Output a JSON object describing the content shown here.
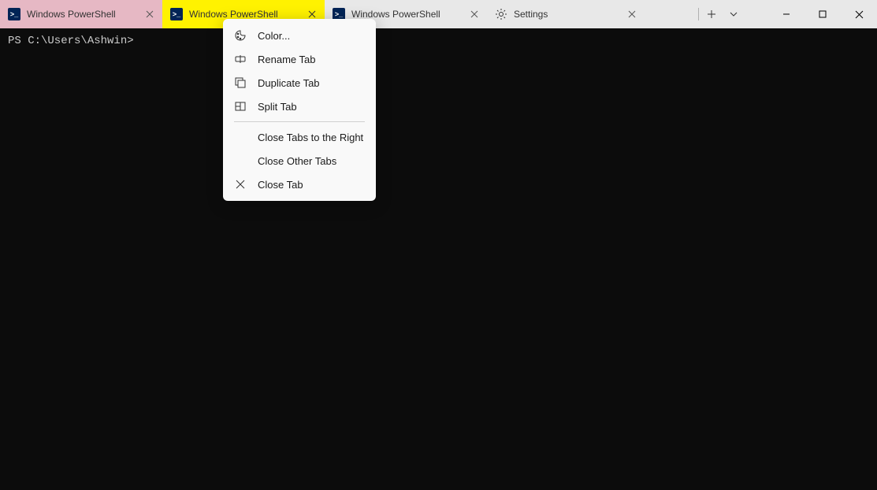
{
  "tabs": [
    {
      "label": "Windows PowerShell",
      "icon": "powershell"
    },
    {
      "label": "Windows PowerShell",
      "icon": "powershell"
    },
    {
      "label": "Windows PowerShell",
      "icon": "powershell"
    },
    {
      "label": "Settings",
      "icon": "settings"
    }
  ],
  "terminal": {
    "prompt": "PS C:\\Users\\Ashwin>"
  },
  "context_menu": {
    "items": [
      {
        "icon": "palette",
        "label": "Color..."
      },
      {
        "icon": "rename",
        "label": "Rename Tab"
      },
      {
        "icon": "duplicate",
        "label": "Duplicate Tab"
      },
      {
        "icon": "split",
        "label": "Split Tab"
      },
      {
        "divider": true
      },
      {
        "icon": "",
        "label": "Close Tabs to the Right"
      },
      {
        "icon": "",
        "label": "Close Other Tabs"
      },
      {
        "icon": "close",
        "label": "Close Tab"
      }
    ]
  }
}
